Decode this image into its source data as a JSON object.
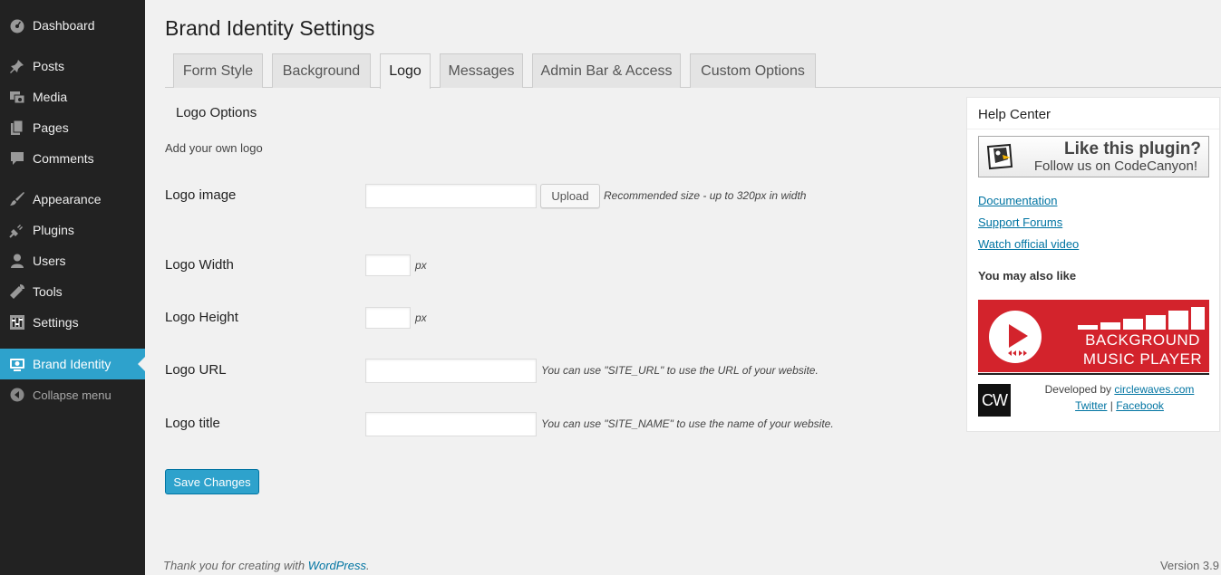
{
  "sidebar": {
    "items": [
      {
        "label": "Dashboard",
        "icon": "dashboard-icon"
      },
      {
        "label": "Posts",
        "icon": "pin-icon"
      },
      {
        "label": "Media",
        "icon": "media-icon"
      },
      {
        "label": "Pages",
        "icon": "pages-icon"
      },
      {
        "label": "Comments",
        "icon": "comment-icon"
      },
      {
        "label": "Appearance",
        "icon": "brush-icon"
      },
      {
        "label": "Plugins",
        "icon": "plug-icon"
      },
      {
        "label": "Users",
        "icon": "user-icon"
      },
      {
        "label": "Tools",
        "icon": "wrench-icon"
      },
      {
        "label": "Settings",
        "icon": "settings-icon"
      },
      {
        "label": "Brand Identity",
        "icon": "monitor-icon",
        "active": true
      }
    ],
    "collapse_label": "Collapse menu"
  },
  "page": {
    "title": "Brand Identity Settings",
    "tabs": [
      "Form Style",
      "Background",
      "Logo",
      "Messages",
      "Admin Bar & Access",
      "Custom Options"
    ],
    "active_tab": "Logo"
  },
  "section": {
    "title": "Logo Options",
    "description": "Add your own logo"
  },
  "fields": {
    "logo_image": {
      "label": "Logo image",
      "value": "",
      "button": "Upload",
      "hint": "Recommended size - up to 320px in width"
    },
    "logo_width": {
      "label": "Logo Width",
      "value": "",
      "unit": "px"
    },
    "logo_height": {
      "label": "Logo Height",
      "value": "",
      "unit": "px"
    },
    "logo_url": {
      "label": "Logo URL",
      "value": "",
      "hint": "You can use \"SITE_URL\" to use the URL of your website."
    },
    "logo_title": {
      "label": "Logo title",
      "value": "",
      "hint": "You can use \"SITE_NAME\" to use the name of your website."
    }
  },
  "save_label": "Save Changes",
  "footer": {
    "text": "Thank you for creating with ",
    "link": "WordPress",
    "suffix": ".",
    "version": "Version 3.9"
  },
  "help_center": {
    "title": "Help Center",
    "like_line1": "Like this plugin?",
    "like_line2": "Follow us on CodeCanyon!",
    "links": [
      "Documentation",
      "Support Forums",
      "Watch official video"
    ],
    "also_like": "You may also like",
    "promo_line1": "BACKGROUND",
    "promo_line2": "MUSIC PLAYER",
    "cw_logo": "CW",
    "developed_by": "Developed by ",
    "developer_link": "circlewaves.com",
    "twitter": "Twitter",
    "separator": " | ",
    "facebook": "Facebook"
  },
  "colors": {
    "sidebar_bg": "#222222",
    "accent": "#2ea2cc",
    "link": "#0074a2",
    "promo_red": "#d3232c"
  }
}
